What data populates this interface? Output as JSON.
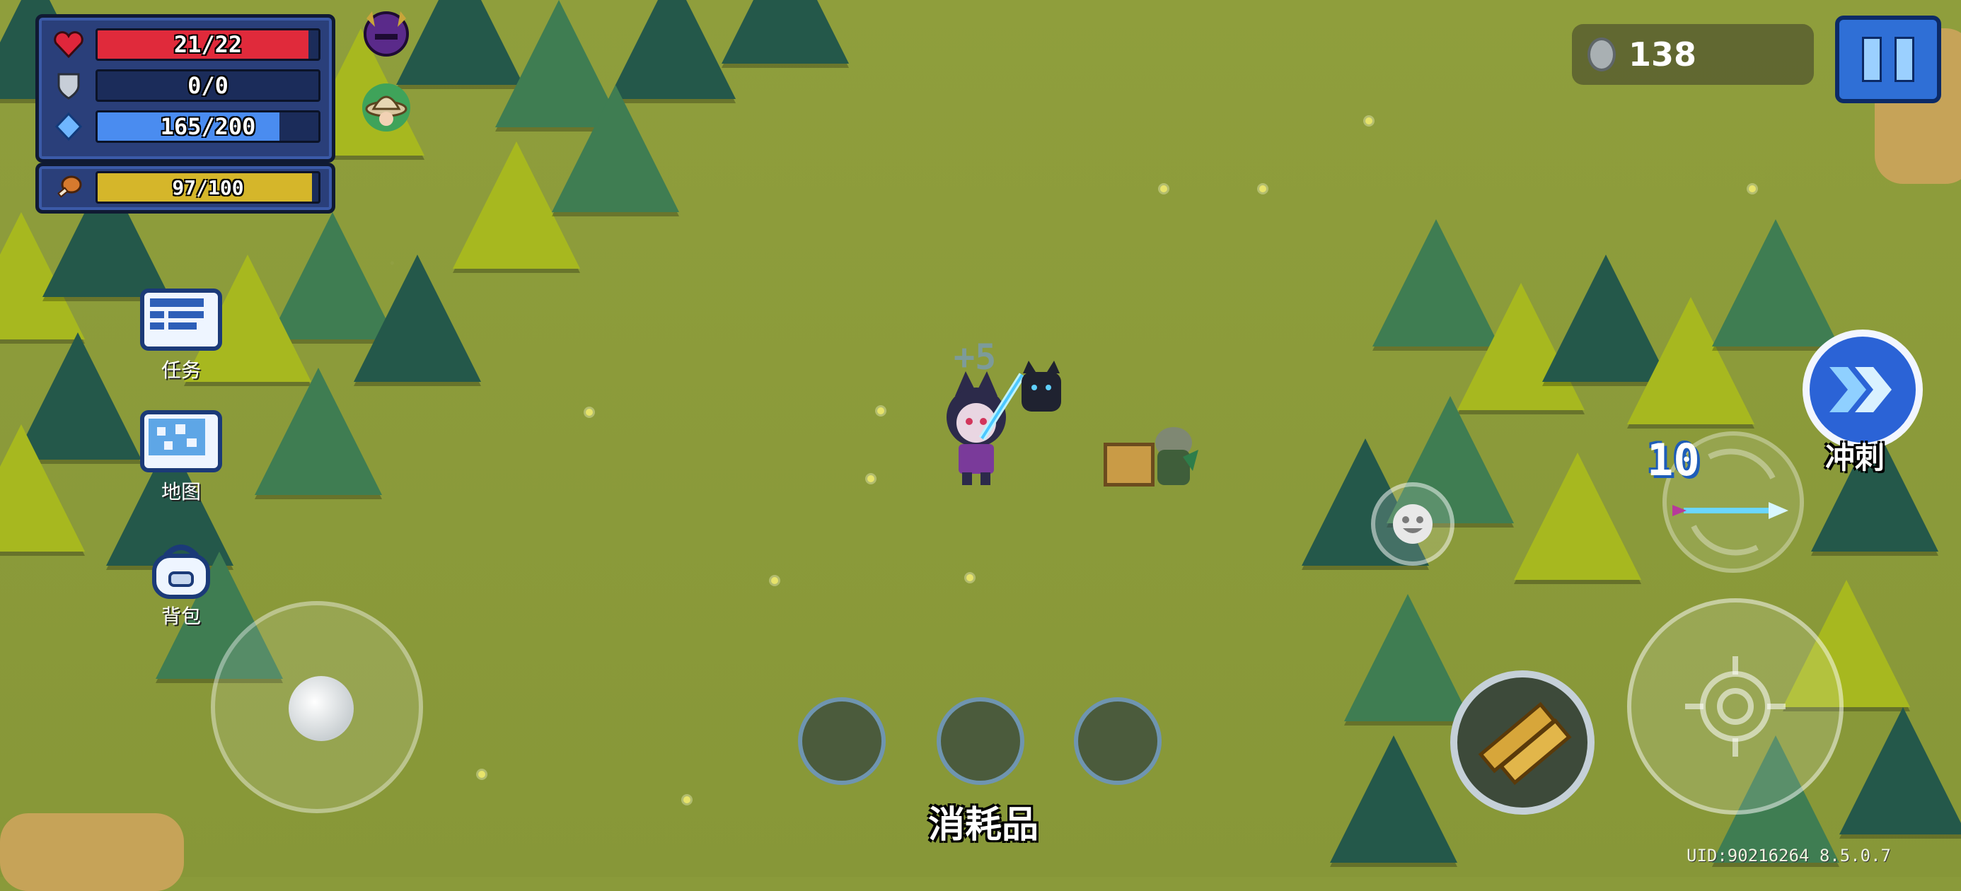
{
  "hud": {
    "health": {
      "text": "21/22",
      "fraction": 0.955,
      "color": "#e02a3b"
    },
    "armor": {
      "text": "0/0",
      "fraction": 0.0,
      "color": "#9aa7c7"
    },
    "energy": {
      "text": "165/200",
      "fraction": 0.825,
      "color": "#4a8cf0"
    },
    "hunger": {
      "text": "97/100",
      "fraction": 0.97,
      "color": "#d5b62a"
    }
  },
  "buffs": [
    {
      "icon": "demon-helmet-icon"
    },
    {
      "icon": "explorer-hat-icon"
    }
  ],
  "side_menu": [
    {
      "icon": "task-list-icon",
      "label": "任务"
    },
    {
      "icon": "map-icon",
      "label": "地图"
    },
    {
      "icon": "backpack-icon",
      "label": "背包"
    }
  ],
  "currency": {
    "icon": "coin-icon",
    "value": "138"
  },
  "pause": {
    "icon": "pause-icon"
  },
  "floating_text": {
    "value": "+5"
  },
  "consumables": {
    "label": "消耗品",
    "slots": [
      {},
      {},
      {}
    ]
  },
  "skill": {
    "label": "冲刺",
    "icon": "dash-chevrons-icon"
  },
  "weapon": {
    "ammo": "10",
    "icon": "magic-staff-icon",
    "swap_icon": "weapon-swap-icon"
  },
  "secondary_weapon": {
    "icon": "golden-pistols-icon"
  },
  "attack": {
    "icon": "crosshair-icon"
  },
  "emote": {
    "icon": "smiley-icon"
  },
  "footer": {
    "uid_text": "UID:90216264 8.5.0.7"
  },
  "colors": {
    "grass": "#8a9a3a",
    "tree_dark": "#24584a",
    "tree_mid": "#3f7d52",
    "tree_light": "#a7b81f",
    "accent_blue": "#2f6fd6"
  }
}
